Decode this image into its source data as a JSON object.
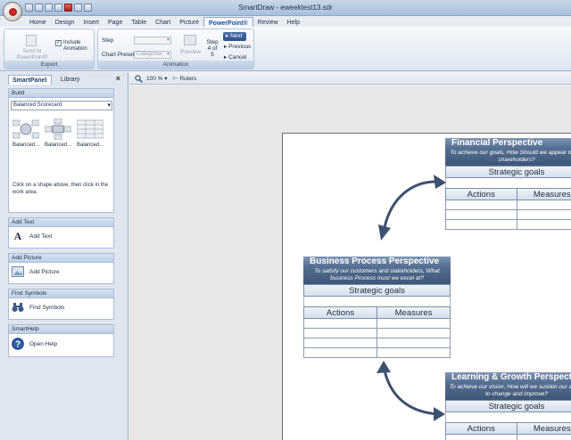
{
  "app": {
    "title": "SmartDraw - eweektest13.sdr",
    "tabs": [
      "Home",
      "Design",
      "Insert",
      "Page",
      "Table",
      "Chart",
      "Picture",
      "PowerPoint®",
      "Review",
      "Help"
    ],
    "active_tab": "PowerPoint®"
  },
  "ribbon": {
    "export": {
      "group_label": "Export",
      "send_label": "Send to PowerPoint®",
      "include_animation_label": "Include Animation",
      "include_animation_checked": true
    },
    "animation": {
      "group_label": "Animation",
      "step_label": "Step",
      "chart_preset_label": "Chart Preset",
      "chart_preset_value": "Categories",
      "preview_label": "Preview",
      "step_counter": "Step 4 of 5",
      "next_label": "Next",
      "previous_label": "Previous",
      "cancel_label": "Cancel"
    }
  },
  "left_panel": {
    "tabs": [
      "SmartPanel",
      "Library"
    ],
    "close_icon": "close-icon",
    "build": {
      "header": "Build",
      "dropdown_value": "Balanced Scorecard",
      "shapes": [
        "Balanced...",
        "Balanced...",
        "Balanced..."
      ],
      "hint": "Click on a shape above, then click in the work area."
    },
    "add_text": {
      "header": "Add Text",
      "label": "Add Text",
      "icon": "text-icon"
    },
    "add_picture": {
      "header": "Add Picture",
      "label": "Add Picture",
      "icon": "picture-icon"
    },
    "find_symbols": {
      "header": "Find Symbols",
      "label": "Find Symbols",
      "icon": "binoculars-icon"
    },
    "smart_help": {
      "header": "SmartHelp",
      "label": "Open Help",
      "icon": "help-icon"
    }
  },
  "toolbar": {
    "zoom": "100 %",
    "rulers_label": "Rulers"
  },
  "diagram": {
    "financial": {
      "title": "Financial Perspective",
      "subtitle": "To achieve our goals, How Should we appear to our shareholders?",
      "goals": "Strategic goals",
      "col1": "Actions",
      "col2": "Measures"
    },
    "business": {
      "title": "Business Process Perspective",
      "subtitle": "To satisfy our customers and stakeholders, What business Process must we excel at?",
      "goals": "Strategic goals",
      "col1": "Actions",
      "col2": "Measures"
    },
    "learning": {
      "title": "Learning & Growth Perspective",
      "subtitle": "To achieve our vision, How will we sustain our ability to change and improve?",
      "goals": "Strategic goals",
      "col1": "Actions",
      "col2": "Measures"
    }
  },
  "colors": {
    "header_dark": "#4f6789",
    "arrow": "#3d5170",
    "accent": "#2c4f86"
  }
}
